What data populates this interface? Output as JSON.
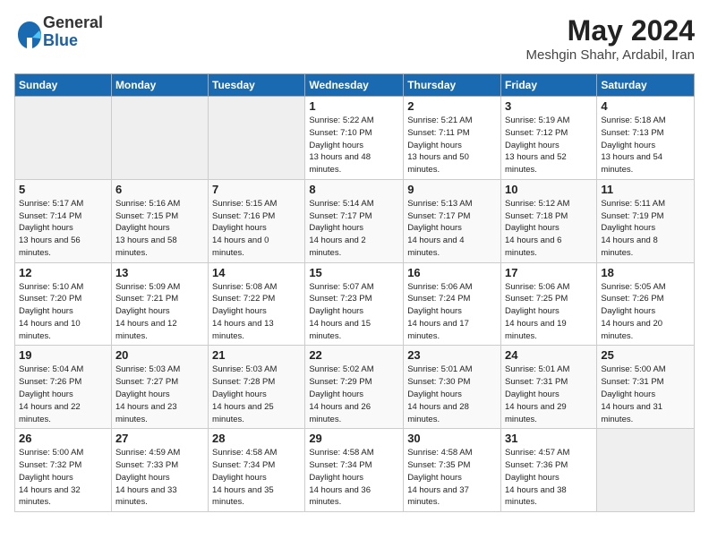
{
  "logo": {
    "general": "General",
    "blue": "Blue"
  },
  "header": {
    "month_year": "May 2024",
    "location": "Meshgin Shahr, Ardabil, Iran"
  },
  "weekdays": [
    "Sunday",
    "Monday",
    "Tuesday",
    "Wednesday",
    "Thursday",
    "Friday",
    "Saturday"
  ],
  "weeks": [
    [
      {
        "day": "",
        "empty": true
      },
      {
        "day": "",
        "empty": true
      },
      {
        "day": "",
        "empty": true
      },
      {
        "day": "1",
        "sunrise": "5:22 AM",
        "sunset": "7:10 PM",
        "daylight": "13 hours and 48 minutes."
      },
      {
        "day": "2",
        "sunrise": "5:21 AM",
        "sunset": "7:11 PM",
        "daylight": "13 hours and 50 minutes."
      },
      {
        "day": "3",
        "sunrise": "5:19 AM",
        "sunset": "7:12 PM",
        "daylight": "13 hours and 52 minutes."
      },
      {
        "day": "4",
        "sunrise": "5:18 AM",
        "sunset": "7:13 PM",
        "daylight": "13 hours and 54 minutes."
      }
    ],
    [
      {
        "day": "5",
        "sunrise": "5:17 AM",
        "sunset": "7:14 PM",
        "daylight": "13 hours and 56 minutes."
      },
      {
        "day": "6",
        "sunrise": "5:16 AM",
        "sunset": "7:15 PM",
        "daylight": "13 hours and 58 minutes."
      },
      {
        "day": "7",
        "sunrise": "5:15 AM",
        "sunset": "7:16 PM",
        "daylight": "14 hours and 0 minutes."
      },
      {
        "day": "8",
        "sunrise": "5:14 AM",
        "sunset": "7:17 PM",
        "daylight": "14 hours and 2 minutes."
      },
      {
        "day": "9",
        "sunrise": "5:13 AM",
        "sunset": "7:17 PM",
        "daylight": "14 hours and 4 minutes."
      },
      {
        "day": "10",
        "sunrise": "5:12 AM",
        "sunset": "7:18 PM",
        "daylight": "14 hours and 6 minutes."
      },
      {
        "day": "11",
        "sunrise": "5:11 AM",
        "sunset": "7:19 PM",
        "daylight": "14 hours and 8 minutes."
      }
    ],
    [
      {
        "day": "12",
        "sunrise": "5:10 AM",
        "sunset": "7:20 PM",
        "daylight": "14 hours and 10 minutes."
      },
      {
        "day": "13",
        "sunrise": "5:09 AM",
        "sunset": "7:21 PM",
        "daylight": "14 hours and 12 minutes."
      },
      {
        "day": "14",
        "sunrise": "5:08 AM",
        "sunset": "7:22 PM",
        "daylight": "14 hours and 13 minutes."
      },
      {
        "day": "15",
        "sunrise": "5:07 AM",
        "sunset": "7:23 PM",
        "daylight": "14 hours and 15 minutes."
      },
      {
        "day": "16",
        "sunrise": "5:06 AM",
        "sunset": "7:24 PM",
        "daylight": "14 hours and 17 minutes."
      },
      {
        "day": "17",
        "sunrise": "5:06 AM",
        "sunset": "7:25 PM",
        "daylight": "14 hours and 19 minutes."
      },
      {
        "day": "18",
        "sunrise": "5:05 AM",
        "sunset": "7:26 PM",
        "daylight": "14 hours and 20 minutes."
      }
    ],
    [
      {
        "day": "19",
        "sunrise": "5:04 AM",
        "sunset": "7:26 PM",
        "daylight": "14 hours and 22 minutes."
      },
      {
        "day": "20",
        "sunrise": "5:03 AM",
        "sunset": "7:27 PM",
        "daylight": "14 hours and 23 minutes."
      },
      {
        "day": "21",
        "sunrise": "5:03 AM",
        "sunset": "7:28 PM",
        "daylight": "14 hours and 25 minutes."
      },
      {
        "day": "22",
        "sunrise": "5:02 AM",
        "sunset": "7:29 PM",
        "daylight": "14 hours and 26 minutes."
      },
      {
        "day": "23",
        "sunrise": "5:01 AM",
        "sunset": "7:30 PM",
        "daylight": "14 hours and 28 minutes."
      },
      {
        "day": "24",
        "sunrise": "5:01 AM",
        "sunset": "7:31 PM",
        "daylight": "14 hours and 29 minutes."
      },
      {
        "day": "25",
        "sunrise": "5:00 AM",
        "sunset": "7:31 PM",
        "daylight": "14 hours and 31 minutes."
      }
    ],
    [
      {
        "day": "26",
        "sunrise": "5:00 AM",
        "sunset": "7:32 PM",
        "daylight": "14 hours and 32 minutes."
      },
      {
        "day": "27",
        "sunrise": "4:59 AM",
        "sunset": "7:33 PM",
        "daylight": "14 hours and 33 minutes."
      },
      {
        "day": "28",
        "sunrise": "4:58 AM",
        "sunset": "7:34 PM",
        "daylight": "14 hours and 35 minutes."
      },
      {
        "day": "29",
        "sunrise": "4:58 AM",
        "sunset": "7:34 PM",
        "daylight": "14 hours and 36 minutes."
      },
      {
        "day": "30",
        "sunrise": "4:58 AM",
        "sunset": "7:35 PM",
        "daylight": "14 hours and 37 minutes."
      },
      {
        "day": "31",
        "sunrise": "4:57 AM",
        "sunset": "7:36 PM",
        "daylight": "14 hours and 38 minutes."
      },
      {
        "day": "",
        "empty": true
      }
    ]
  ]
}
